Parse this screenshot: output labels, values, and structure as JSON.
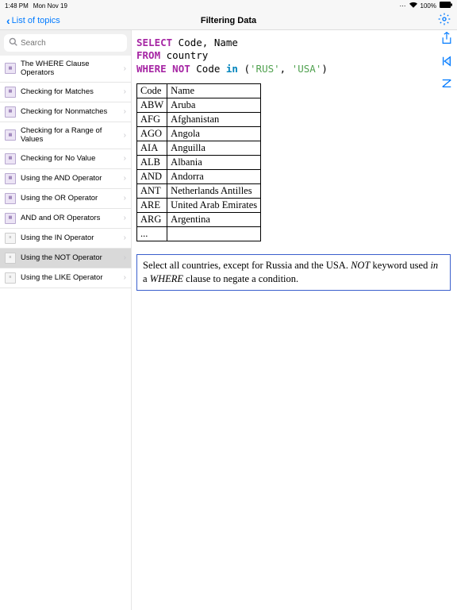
{
  "status": {
    "time": "1:48 PM",
    "date": "Mon Nov 19",
    "battery": "100%"
  },
  "nav": {
    "back": "List of topics",
    "title": "Filtering Data"
  },
  "search": {
    "placeholder": "Search"
  },
  "topics": [
    {
      "label": "The WHERE Clause Operators",
      "type": "sql"
    },
    {
      "label": "Checking for Matches",
      "type": "sql"
    },
    {
      "label": "Checking for Nonmatches",
      "type": "sql"
    },
    {
      "label": "Checking for a Range of Values",
      "type": "sql"
    },
    {
      "label": "Checking for No Value",
      "type": "sql"
    },
    {
      "label": "Using the AND Operator",
      "type": "sql"
    },
    {
      "label": "Using the OR Operator",
      "type": "sql"
    },
    {
      "label": "AND and OR Operators",
      "type": "sql"
    },
    {
      "label": "Using the IN Operator",
      "type": "doc"
    },
    {
      "label": "Using the NOT Operator",
      "type": "doc",
      "selected": true
    },
    {
      "label": "Using the LIKE Operator",
      "type": "doc"
    }
  ],
  "sql": {
    "line1": {
      "kw": "SELECT",
      "rest": " Code, Name"
    },
    "line2": {
      "kw": "FROM",
      "rest": " country"
    },
    "line3": {
      "kw1": "WHERE",
      "kw2": "NOT",
      "mid": " Code ",
      "kw3": "in",
      "paren_open": " (",
      "s1": "'RUS'",
      "comma": ", ",
      "s2": "'USA'",
      "paren_close": ")"
    }
  },
  "table": {
    "header": [
      "Code",
      "Name"
    ],
    "rows": [
      [
        "ABW",
        "Aruba"
      ],
      [
        "AFG",
        "Afghanistan"
      ],
      [
        "AGO",
        "Angola"
      ],
      [
        "AIA",
        "Anguilla"
      ],
      [
        "ALB",
        "Albania"
      ],
      [
        "AND",
        "Andorra"
      ],
      [
        "ANT",
        "Netherlands Antilles"
      ],
      [
        "ARE",
        "United Arab Emirates"
      ],
      [
        "ARG",
        "Argentina"
      ],
      [
        "...",
        ""
      ]
    ]
  },
  "explain": {
    "t1": "Select all countries, except for Russia and the USA. ",
    "i1": "NOT",
    "t2": " keyword used ",
    "i2": "in",
    "t3": " a ",
    "i3": "WHERE",
    "t4": " clause to negate a condition."
  }
}
